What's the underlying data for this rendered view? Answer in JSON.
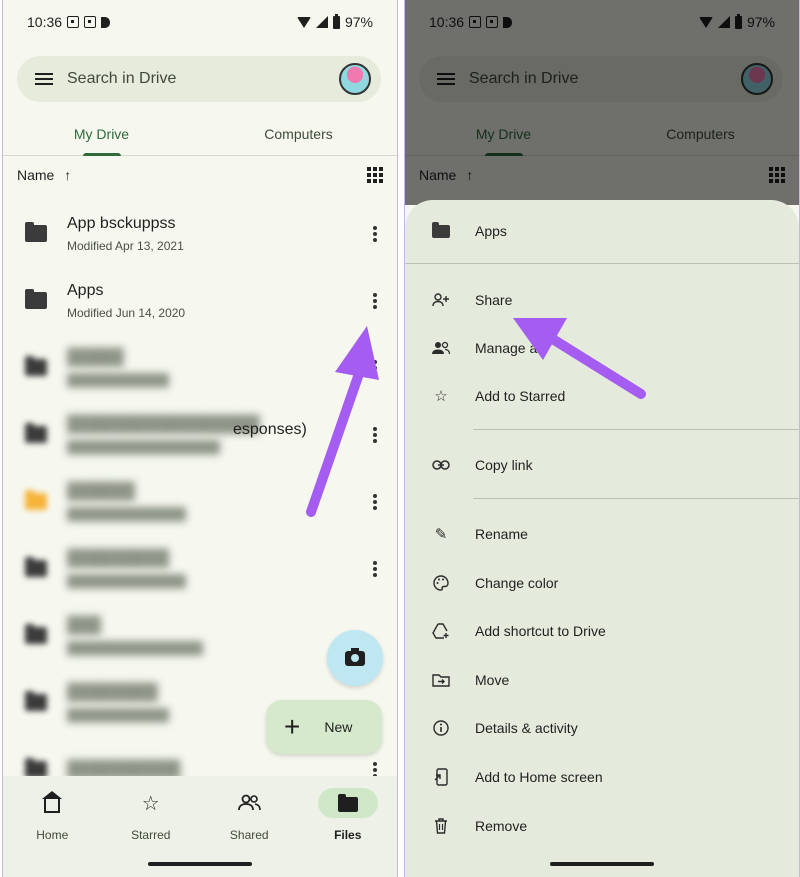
{
  "status": {
    "time": "10:36",
    "battery": "97%"
  },
  "search": {
    "placeholder": "Search in Drive"
  },
  "tabs": [
    {
      "label": "My Drive",
      "active": true
    },
    {
      "label": "Computers",
      "active": false
    }
  ],
  "sort": {
    "label": "Name",
    "arrow": "↑"
  },
  "files": [
    {
      "name": "App bsckuppss",
      "modified": "Modified Apr 13, 2021"
    },
    {
      "name": "Apps",
      "modified": "Modified Jun 14, 2020"
    },
    {
      "name_suffix": "esponses)"
    }
  ],
  "fab": {
    "new_label": "New"
  },
  "nav": [
    {
      "label": "Home",
      "icon": "home-icon"
    },
    {
      "label": "Starred",
      "icon": "star-icon"
    },
    {
      "label": "Shared",
      "icon": "people-icon"
    },
    {
      "label": "Files",
      "icon": "folder-icon",
      "active": true
    }
  ],
  "sheet": {
    "title": "Apps",
    "items": [
      {
        "label": "Share",
        "icon": "person-add-icon"
      },
      {
        "label": "Manage a",
        "icon": "manage-people-icon"
      },
      {
        "label": "Add to Starred",
        "icon": "star-outline-icon"
      },
      {
        "label": "Copy link",
        "icon": "link-icon"
      },
      {
        "label": "Rename",
        "icon": "pencil-icon"
      },
      {
        "label": "Change color",
        "icon": "palette-icon"
      },
      {
        "label": "Add shortcut to Drive",
        "icon": "shortcut-icon"
      },
      {
        "label": "Move",
        "icon": "move-folder-icon"
      },
      {
        "label": "Details & activity",
        "icon": "info-icon"
      },
      {
        "label": "Add to Home screen",
        "icon": "home-screen-icon"
      },
      {
        "label": "Remove",
        "icon": "trash-icon"
      }
    ]
  },
  "annotation_color": "#a55cf0"
}
